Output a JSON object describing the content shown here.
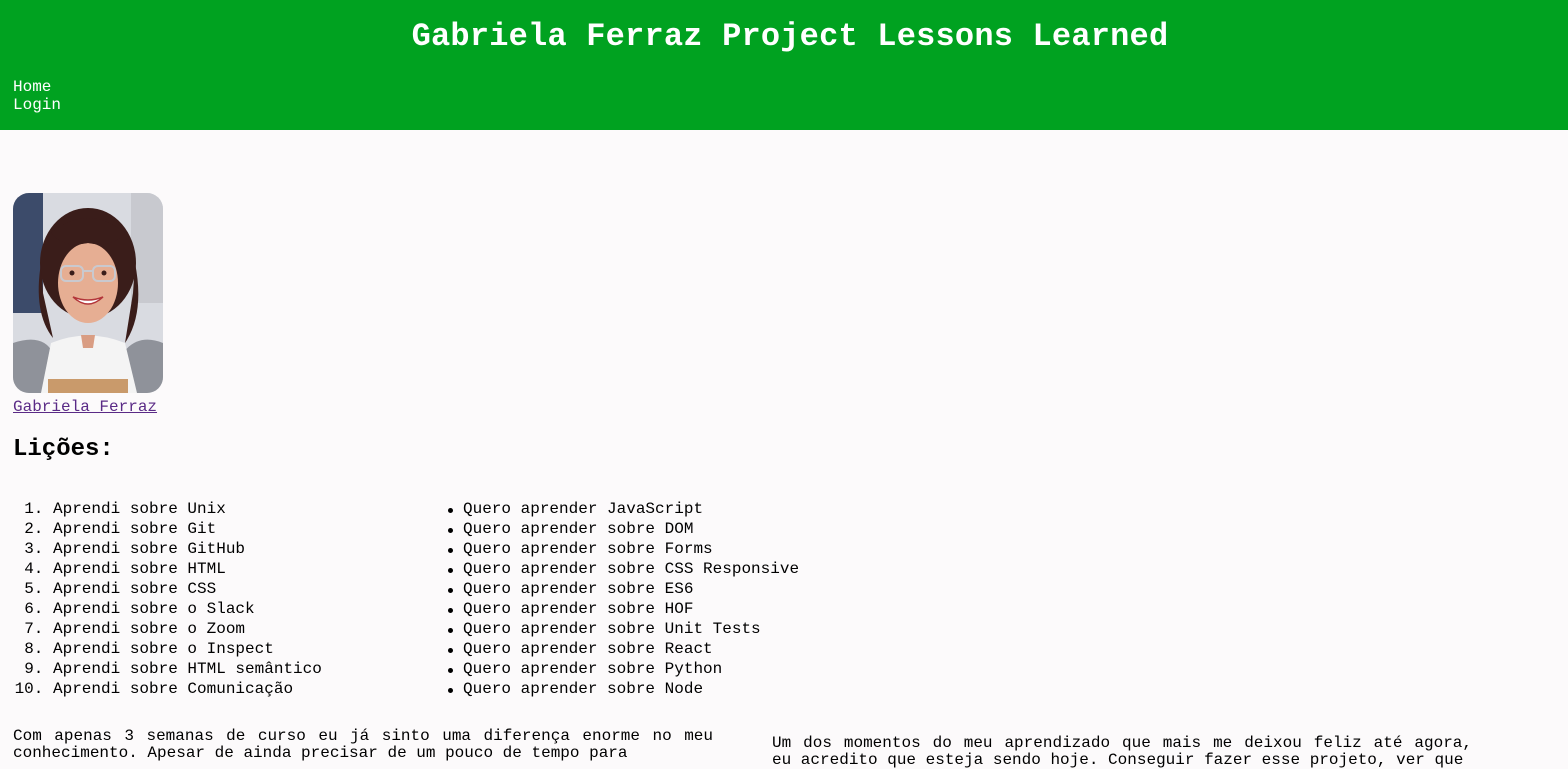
{
  "header": {
    "title": "Gabriela Ferraz Project Lessons Learned"
  },
  "nav": {
    "items": [
      "Home",
      "Login"
    ]
  },
  "profile": {
    "name": "Gabriela Ferraz"
  },
  "lessons": {
    "title": "Lições:",
    "learned": [
      {
        "num": "1.",
        "text": "Aprendi sobre Unix"
      },
      {
        "num": "2.",
        "text": "Aprendi sobre Git"
      },
      {
        "num": "3.",
        "text": "Aprendi sobre GitHub"
      },
      {
        "num": "4.",
        "text": "Aprendi sobre HTML"
      },
      {
        "num": "5.",
        "text": "Aprendi sobre CSS"
      },
      {
        "num": "6.",
        "text": "Aprendi sobre o Slack"
      },
      {
        "num": "7.",
        "text": "Aprendi sobre o Zoom"
      },
      {
        "num": "8.",
        "text": "Aprendi sobre o Inspect"
      },
      {
        "num": "9.",
        "text": "Aprendi sobre HTML semântico"
      },
      {
        "num": "10.",
        "text": "Aprendi sobre Comunicação"
      }
    ],
    "want_to_learn": [
      "Quero aprender JavaScript",
      "Quero aprender sobre DOM",
      "Quero aprender sobre Forms",
      "Quero aprender sobre CSS Responsive",
      "Quero aprender sobre ES6",
      "Quero aprender sobre HOF",
      "Quero aprender sobre Unit Tests",
      "Quero aprender sobre React",
      "Quero aprender sobre Python",
      "Quero aprender sobre Node"
    ]
  },
  "paragraphs": {
    "left": "Com apenas 3 semanas de curso eu já sinto uma diferença enorme no meu conhecimento. Apesar de ainda precisar de um pouco de tempo para",
    "right": "Um dos momentos do meu aprendizado que mais me deixou feliz até agora, eu acredito que esteja sendo hoje. Conseguir fazer esse projeto, ver que"
  },
  "colors": {
    "header_bg": "#00a220",
    "page_bg": "#fcfafb",
    "link_visited": "#5a2a86"
  }
}
